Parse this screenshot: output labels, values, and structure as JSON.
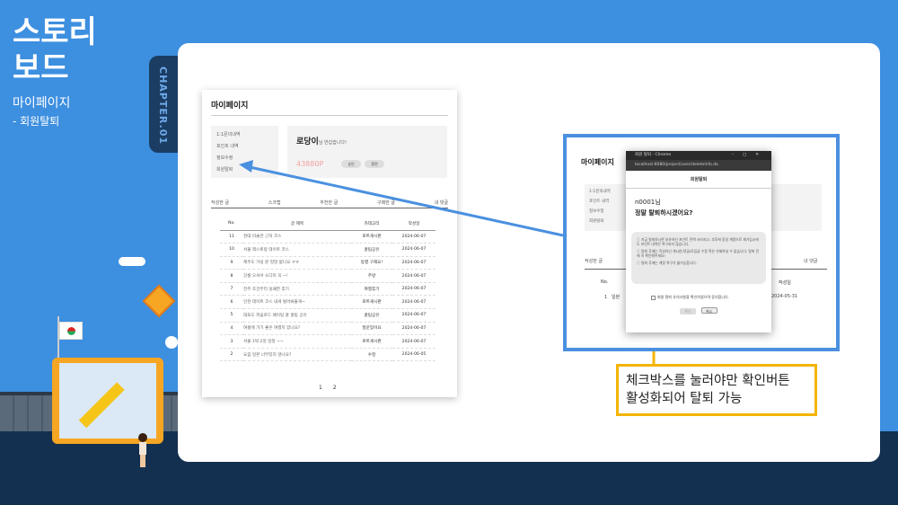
{
  "slide": {
    "title_line1": "스토리",
    "title_line2": "보드",
    "subtitle": "마이페이지",
    "subtitle_sub": " - 회원탈퇴",
    "chapter": "CHAPTER.01"
  },
  "left_screen": {
    "heading": "마이페이지",
    "menu": [
      "1:1문의내역",
      "포인트 내역",
      "정보수정",
      "회원탈퇴"
    ],
    "profile_name": "로당이",
    "profile_greet": "님 반갑습니다!",
    "points": "43880P",
    "btn_charge": "승인",
    "btn_use": "환전",
    "tabs": [
      "작성한 글",
      "스크랩",
      "추천한 글",
      "구매한 글",
      "내 댓글"
    ],
    "table_headers": [
      "No.",
      "글 제목",
      "카테고리",
      "작성일"
    ],
    "rows": [
      [
        "11",
        "천대 미술관 근처 코스",
        "로트게시판",
        "2024-06-07"
      ],
      [
        "10",
        "서울 레스토랑 데이트 코스",
        "꿀팁공유",
        "2024-06-07"
      ],
      [
        "9",
        "제주도 가실 분 정말 없나요 ㅠㅠ",
        "동행 구해요!",
        "2024-06-07"
      ],
      [
        "8",
        "강릉 오셔서 소다미 꼭 ~!",
        "주방",
        "2024-06-07"
      ],
      [
        "7",
        "전주 조건부터 실패한 후기",
        "여행후기",
        "2024-06-07"
      ],
      [
        "6",
        "인천 데이트 코스 내게 털어봐줄게~",
        "로트게시판",
        "2024-06-07"
      ],
      [
        "5",
        "대포도 피움로드 페이팅 꿀 꿀팁 공유",
        "꿀팁공유",
        "2024-06-07"
      ],
      [
        "4",
        "여름에 가기 좋은 여행지 있나요?",
        "질문있어요",
        "2024-06-07"
      ],
      [
        "3",
        "서울 1박 2일 일정 ~~",
        "로트게시판",
        "2024-06-07"
      ],
      [
        "2",
        "요즘 일본 너무있지 않나요?",
        "수정",
        "2024-06-05"
      ]
    ],
    "pages": [
      "1",
      "2"
    ]
  },
  "right_screen": {
    "heading": "마이페이지",
    "menu": [
      "1:1문의내역",
      "포인트 내역",
      "정보수정",
      "회원탈퇴"
    ],
    "tab_left": "작성한 글",
    "tab_right": "내 댓글",
    "col_no": "No.",
    "col_date": "작성일",
    "row_no": "1",
    "row_title": "일본",
    "row_date": "2024-05-31"
  },
  "dialog": {
    "window_title": "회원 탈퇴 - Chrome",
    "url": "localhost:8080/project/user/deleteInfo.do",
    "header": "회원탈퇴",
    "question_line1": "n0001님",
    "question_line2": "정말 탈퇴하시겠어요?",
    "notices": [
      "ⓘ 지금 탈퇴하시면 보유하신 포인트 전액 사라지고, 추후에 동일 계정으로 재가입시에도 포인트 내역은 복구되지 않습니다.",
      "ⓘ 탈퇴 후에는 작성하신 게시판/댓글/모임글 수정 혹은 삭제하실 수 없습니다. 탈퇴 전에 꼭 확인해주세요!",
      "ⓘ 탈퇴 후에는 계정 복구가 불가능합니다."
    ],
    "checkbox_label": "회원 탈퇴 유의사항을 확인하였으며 동의합니다.",
    "confirm_label": "확인",
    "cancel_label": "취소"
  },
  "callout": {
    "line1": "체크박스를 눌러야만 확인버튼",
    "line2": "활성화되어 탈퇴 가능"
  },
  "colors": {
    "background": "#3d8fe0",
    "accent_frame": "#4a90e0",
    "callout_border": "#f4b400",
    "chapter_tab": "#1b3d63"
  }
}
